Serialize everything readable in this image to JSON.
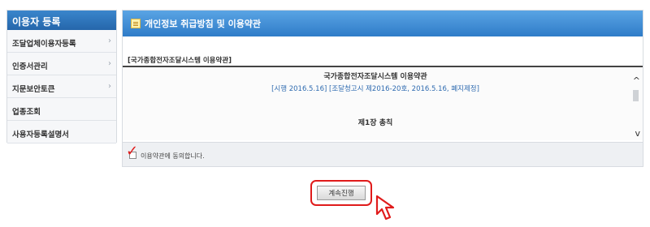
{
  "sidebar": {
    "title": "이용자 등록",
    "items": [
      {
        "label": "조달업체이용자등록",
        "has_chevron": true
      },
      {
        "label": "인증서관리",
        "has_chevron": true
      },
      {
        "label": "지문보안토큰",
        "has_chevron": true
      },
      {
        "label": "업종조회",
        "has_chevron": false
      },
      {
        "label": "사용자등록설명서",
        "has_chevron": false
      }
    ],
    "chevron_icon": "›"
  },
  "main": {
    "header_title": "개인정보 취급방침 및 이용약관",
    "header_icon": "memo-icon",
    "section_title": "[국가종합전자조달시스템 이용약관]",
    "terms": {
      "title": "국가종합전자조달시스템 이용약관",
      "subtitle": "[시행 2016.5.16] [조달청고시 제2016-20호, 2016.5.16, 폐지제정]",
      "chapter": "제1장 총칙",
      "scroll_up_icon": "^",
      "scroll_down_icon": "v"
    },
    "agree": {
      "label": "이용약관에 동의합니다.",
      "checked": true,
      "checkmark": "✓"
    }
  },
  "continue_button": {
    "label": "계속진행"
  },
  "colors": {
    "sidebar_header": "#2f73b8",
    "main_header": "#3f8ed7",
    "highlight": "#e01b1b",
    "link": "#2f6bb0"
  }
}
